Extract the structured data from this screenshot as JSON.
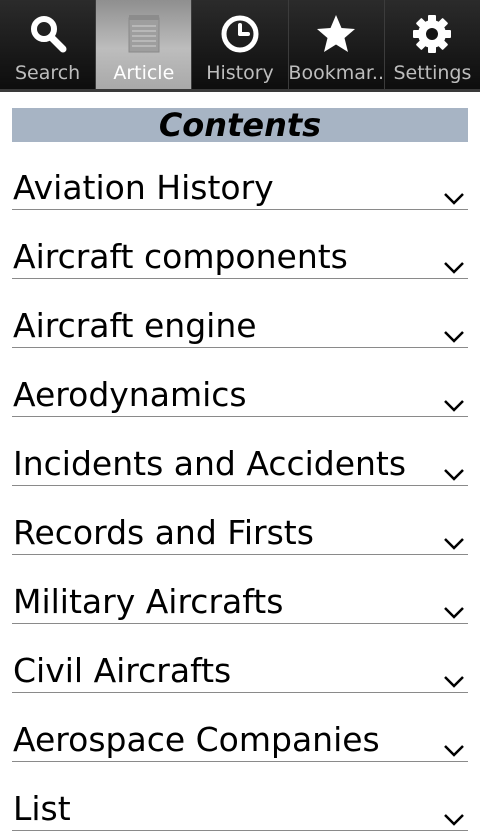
{
  "tabs": [
    {
      "label": "Search",
      "icon": "search-icon",
      "active": false
    },
    {
      "label": "Article",
      "icon": "notepad-icon",
      "active": true
    },
    {
      "label": "History",
      "icon": "clock-icon",
      "active": false
    },
    {
      "label": "Bookmar..",
      "icon": "star-icon",
      "active": false
    },
    {
      "label": "Settings",
      "icon": "gear-icon",
      "active": false
    }
  ],
  "contents": {
    "title": "Contents",
    "items": [
      "Aviation History",
      "Aircraft components",
      "Aircraft engine",
      "Aerodynamics",
      "Incidents and Accidents",
      "Records and Firsts",
      "Military Aircrafts",
      "Civil Aircrafts",
      "Aerospace Companies",
      "List"
    ]
  },
  "colors": {
    "tabbar_bg": "#111111",
    "active_tab": "#b4b4b4",
    "header_bg": "#a7b4c4"
  }
}
